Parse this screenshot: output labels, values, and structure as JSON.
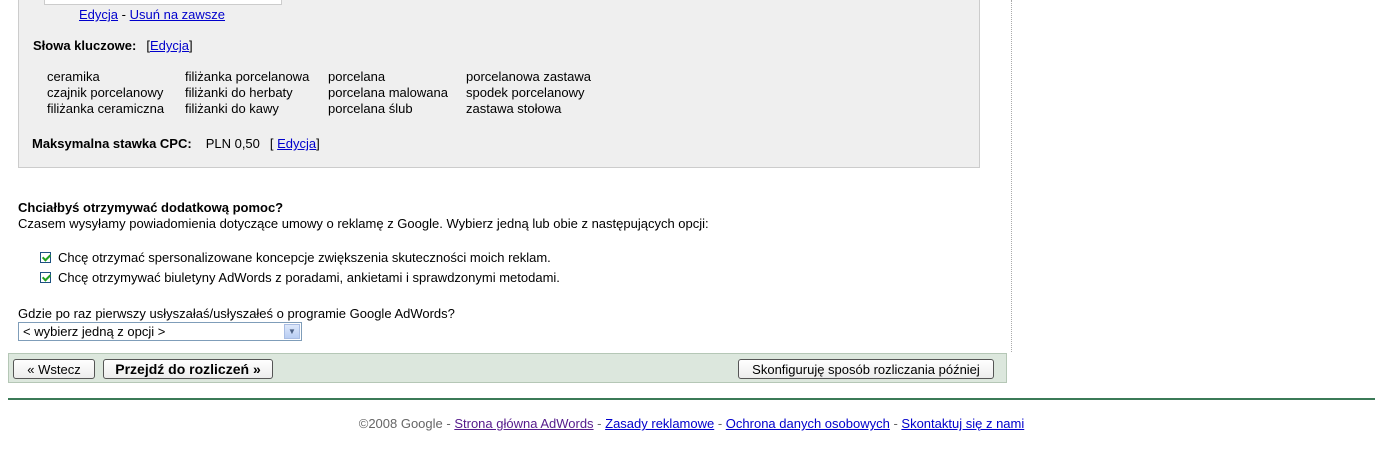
{
  "ad_preview": {
    "edit_link": "Edycja",
    "separator": "-",
    "delete_link": "Usuń na zawsze"
  },
  "keywords": {
    "label": "Słowa kluczowe:",
    "edit_link": "Edycja",
    "bracket_open": "[",
    "bracket_close": "]",
    "columns": [
      [
        "ceramika",
        "czajnik porcelanowy",
        "filiżanka ceramiczna"
      ],
      [
        "filiżanka porcelanowa",
        "filiżanki do herbaty",
        "filiżanki do kawy"
      ],
      [
        "porcelana",
        "porcelana malowana",
        "porcelana ślub"
      ],
      [
        "porcelanowa zastawa",
        "spodek porcelanowy",
        "zastawa stołowa"
      ]
    ]
  },
  "cpc": {
    "label": "Maksymalna stawka CPC:",
    "amount": "PLN 0,50",
    "bracket_open": "[",
    "edit_link": "Edycja",
    "bracket_close": "]"
  },
  "help": {
    "title": "Chciałbyś otrzymywać dodatkową pomoc?",
    "description": "Czasem wysyłamy powiadomienia dotyczące umowy o reklamę z Google. Wybierz jedną lub obie z następujących opcji:",
    "options": [
      {
        "label": "Chcę otrzymać spersonalizowane koncepcje zwiększenia skuteczności moich reklam.",
        "checked": true
      },
      {
        "label": "Chcę otrzymywać biuletyny AdWords z poradami, ankietami i sprawdzonymi metodami.",
        "checked": true
      }
    ]
  },
  "source_question": {
    "label": "Gdzie po raz pierwszy usłyszałaś/usłyszałeś o programie Google AdWords?",
    "selected": "< wybierz jedną z opcji >"
  },
  "actions": {
    "back": "« Wstecz",
    "next": "Przejdź do rozliczeń »",
    "later": "Skonfiguruję sposób rozliczania później"
  },
  "footer": {
    "copyright": "©2008 Google",
    "sep": " - ",
    "links": [
      "Strona główna AdWords",
      "Zasady reklamowe",
      "Ochrona danych osobowych",
      "Skontaktuj się z nami"
    ]
  },
  "colors": {
    "link": "#0000cc",
    "visited_link": "#551a8b",
    "panel_bg": "#efefef",
    "action_bar_bg": "#dce7dd",
    "footer_line": "#3b7a57",
    "checkbox_check": "#21a121"
  }
}
